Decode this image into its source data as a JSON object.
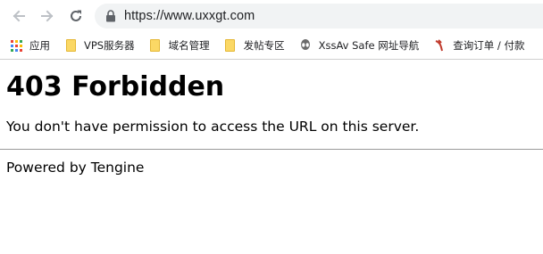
{
  "browser": {
    "url": "https://www.uxxgt.com",
    "bookmarks": [
      {
        "label": "应用",
        "icon": "apps-grid-icon"
      },
      {
        "label": "VPS服务器",
        "icon": "folder-icon"
      },
      {
        "label": "域名管理",
        "icon": "folder-icon"
      },
      {
        "label": "发帖专区",
        "icon": "folder-icon"
      },
      {
        "label": "XssAv Safe 网址导航",
        "icon": "alien-icon"
      },
      {
        "label": "查询订单 / 付款",
        "icon": "bookmark-favicon-icon"
      }
    ]
  },
  "page": {
    "heading": "403 Forbidden",
    "message": "You don't have permission to access the URL on this server.",
    "footer": "Powered by Tengine"
  },
  "colors": {
    "omnibox_bg": "#f1f3f4",
    "folder": "#fbd865",
    "apps_icon": [
      "#ea4335",
      "#fbbc05",
      "#34a853",
      "#4285f4"
    ]
  }
}
